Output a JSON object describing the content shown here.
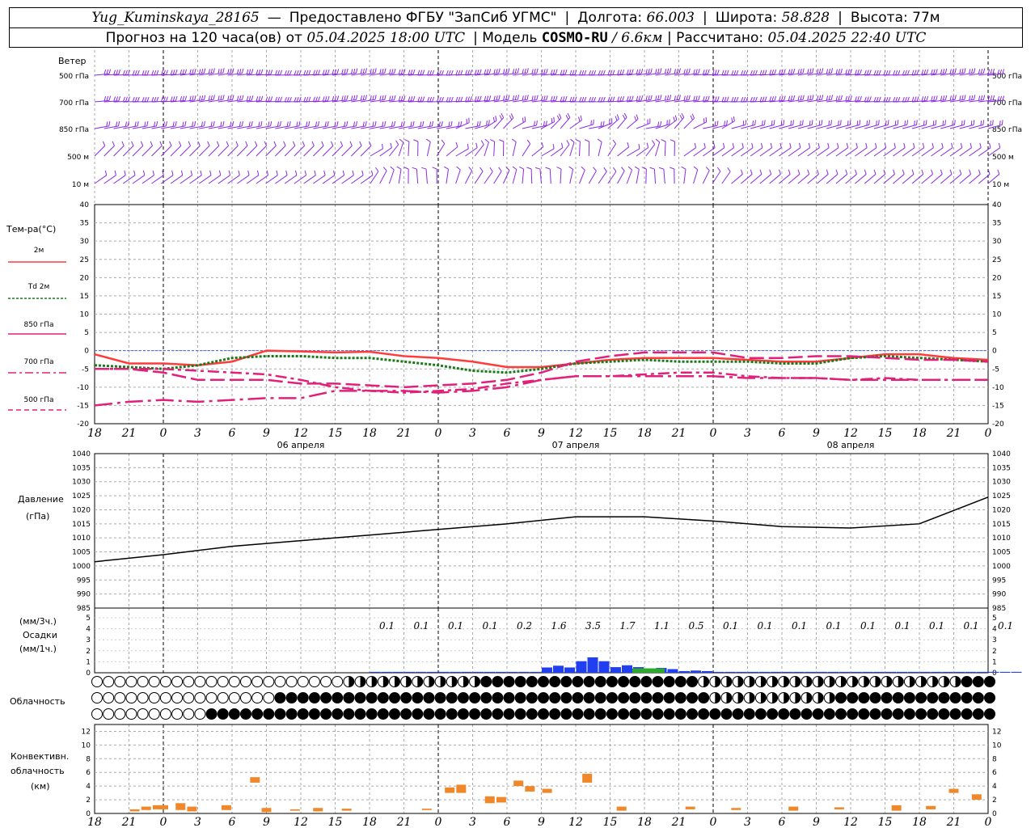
{
  "header": {
    "station": "Yug_Kuminskaya_28165",
    "dash": "—",
    "provided_by": "Предоставлено ФГБУ \"ЗапСиб УГМС\"",
    "lon_label": "Долгота:",
    "lon": "66.003",
    "lat_label": "Широта:",
    "lat": "58.828",
    "alt_label": "Высота:",
    "alt": "77м",
    "sep": "|",
    "fc_label": "Прогноз на 120 часа(ов) от",
    "fc_time": "05.04.2025 18:00 UTC",
    "model_label": "Модель",
    "model": "COSMO-RU",
    "model_res": "/ 6.6км",
    "calc_label": "Рассчитано:",
    "calc_time": "05.04.2025 22:40 UTC"
  },
  "wind": {
    "title": "Ветер",
    "levels": [
      "500 гПа",
      "700 гПа",
      "850 гПа",
      "500 м",
      "10 м"
    ],
    "color": "#8a2be2"
  },
  "temperature": {
    "title": "Тем-ра(°C)",
    "legend": [
      "2м",
      "Td 2м",
      "850 гПа",
      "700 гПа",
      "500 гПа"
    ],
    "colors": {
      "t2m": "#ff3b3b",
      "td2m": "#1a7a1a",
      "lev": "#e0207a"
    },
    "yticks": [
      "40",
      "35",
      "30",
      "25",
      "20",
      "15",
      "10",
      "5",
      "0",
      "-5",
      "-10",
      "-15",
      "-20"
    ]
  },
  "pressure": {
    "title1": "Давление",
    "title2": "(гПа)",
    "yticks": [
      "1040",
      "1035",
      "1030",
      "1025",
      "1020",
      "1015",
      "1010",
      "1005",
      "1000",
      "995",
      "990",
      "985"
    ]
  },
  "precip": {
    "label1": "(мм/3ч.)",
    "label2": "Осадки",
    "label3": "(мм/1ч.)",
    "yticks": [
      "5",
      "4",
      "3",
      "2",
      "1",
      "0"
    ],
    "values3h": [
      "0.1",
      "0.1",
      "0.1",
      "0.1",
      "0.2",
      "1.6",
      "3.5",
      "1.7",
      "1.1",
      "0.5",
      "0.1",
      "0.1",
      "0.1",
      "0.1",
      "0.1",
      "0.1",
      "0.1",
      "0.1",
      "0.1"
    ]
  },
  "clouds": {
    "label": "Облачность"
  },
  "convective": {
    "label1": "Конвективн.",
    "label2": "облачность",
    "label3": "(км)",
    "yticks": [
      "12",
      "10",
      "8",
      "6",
      "4",
      "2",
      "0"
    ],
    "color": "#f0882a"
  },
  "time_axis": {
    "hours": [
      "18",
      "21",
      "0",
      "3",
      "6",
      "9",
      "12",
      "15",
      "18",
      "21",
      "0",
      "3",
      "6",
      "9",
      "12",
      "15",
      "18",
      "21",
      "0",
      "3",
      "6",
      "9",
      "12",
      "15",
      "18",
      "21",
      "0"
    ],
    "dates": [
      "06 апреля",
      "07 апреля",
      "08 апреля"
    ]
  },
  "chart_data": [
    {
      "type": "line",
      "title": "Тем-ра(°C)",
      "x_hours_from_start": [
        0,
        3,
        6,
        9,
        12,
        15,
        18,
        21,
        24,
        27,
        30,
        33,
        36,
        39,
        42,
        45,
        48,
        51,
        54,
        57,
        60,
        63,
        66,
        69,
        72,
        75,
        78
      ],
      "series": [
        {
          "name": "2м",
          "values": [
            -1,
            -3.5,
            -3.5,
            -4,
            -3,
            0,
            -0.2,
            -0.5,
            -0.3,
            -1.5,
            -2,
            -3,
            -4.5,
            -4.5,
            -3.5,
            -2.5,
            -2,
            -2,
            -2,
            -2.5,
            -3,
            -3,
            -2,
            -1,
            -1,
            -2,
            -2.5
          ]
        },
        {
          "name": "Td 2м",
          "values": [
            -4,
            -4.5,
            -5,
            -4,
            -2,
            -1.5,
            -1.5,
            -2,
            -2,
            -3,
            -4,
            -5.5,
            -6,
            -5,
            -3.5,
            -3,
            -2.5,
            -3,
            -3,
            -3,
            -3.5,
            -3.5,
            -2,
            -1.5,
            -2,
            -2.5,
            -3
          ]
        },
        {
          "name": "850 гПа",
          "values": [
            -5,
            -5,
            -6,
            -8,
            -8,
            -8,
            -9,
            -9,
            -9.5,
            -10,
            -9.5,
            -9,
            -8,
            -6,
            -3,
            -1.5,
            -0.5,
            -0.5,
            -0.5,
            -2,
            -2,
            -1.5,
            -1.5,
            -2,
            -2.5,
            -2.5,
            -3
          ]
        },
        {
          "name": "700 гПа",
          "values": [
            -5,
            -5,
            -5,
            -5.5,
            -6,
            -6.5,
            -8,
            -10,
            -11,
            -11.5,
            -11,
            -10.5,
            -9,
            -8,
            -7,
            -7,
            -6.5,
            -6,
            -6,
            -7,
            -7.5,
            -7.5,
            -8,
            -7.5,
            -8,
            -8,
            -8
          ]
        },
        {
          "name": "500 гПа",
          "values": [
            -15,
            -14,
            -13.5,
            -14,
            -13.5,
            -13,
            -13,
            -11,
            -11,
            -11,
            -11.5,
            -11,
            -10,
            -8,
            -7,
            -7,
            -7,
            -7,
            -7,
            -7.5,
            -7.5,
            -7.5,
            -8,
            -8,
            -8,
            -8,
            -8
          ]
        }
      ],
      "ylim": [
        -20,
        40
      ]
    },
    {
      "type": "line",
      "title": "Давление (гПа)",
      "x_hours_from_start": [
        0,
        6,
        12,
        18,
        24,
        30,
        36,
        42,
        48,
        54,
        60,
        66,
        72,
        78
      ],
      "series": [
        {
          "name": "Давление",
          "values": [
            1001.5,
            1004,
            1007,
            1009,
            1011,
            1013,
            1015,
            1017.5,
            1017.5,
            1016,
            1014,
            1013.5,
            1015,
            1024.5
          ]
        }
      ],
      "ylim": [
        985,
        1040
      ]
    },
    {
      "type": "bar",
      "title": "Осадки",
      "categories": [
        "0-3",
        "3-6",
        "6-9",
        "9-12",
        "12-15",
        "15-18",
        "18-21",
        "21-0",
        "0-3",
        "3-6",
        "6-9",
        "9-12",
        "12-15",
        "15-18",
        "18-21",
        "21-0",
        "0-3",
        "3-6",
        "6-9"
      ],
      "values": [
        0.1,
        0.1,
        0.1,
        0.1,
        0.2,
        1.6,
        3.5,
        1.7,
        1.1,
        0.5,
        0.1,
        0.1,
        0.1,
        0.1,
        0.1,
        0.1,
        0.1,
        0.1,
        0.1
      ],
      "ylim": [
        0,
        5
      ]
    }
  ]
}
